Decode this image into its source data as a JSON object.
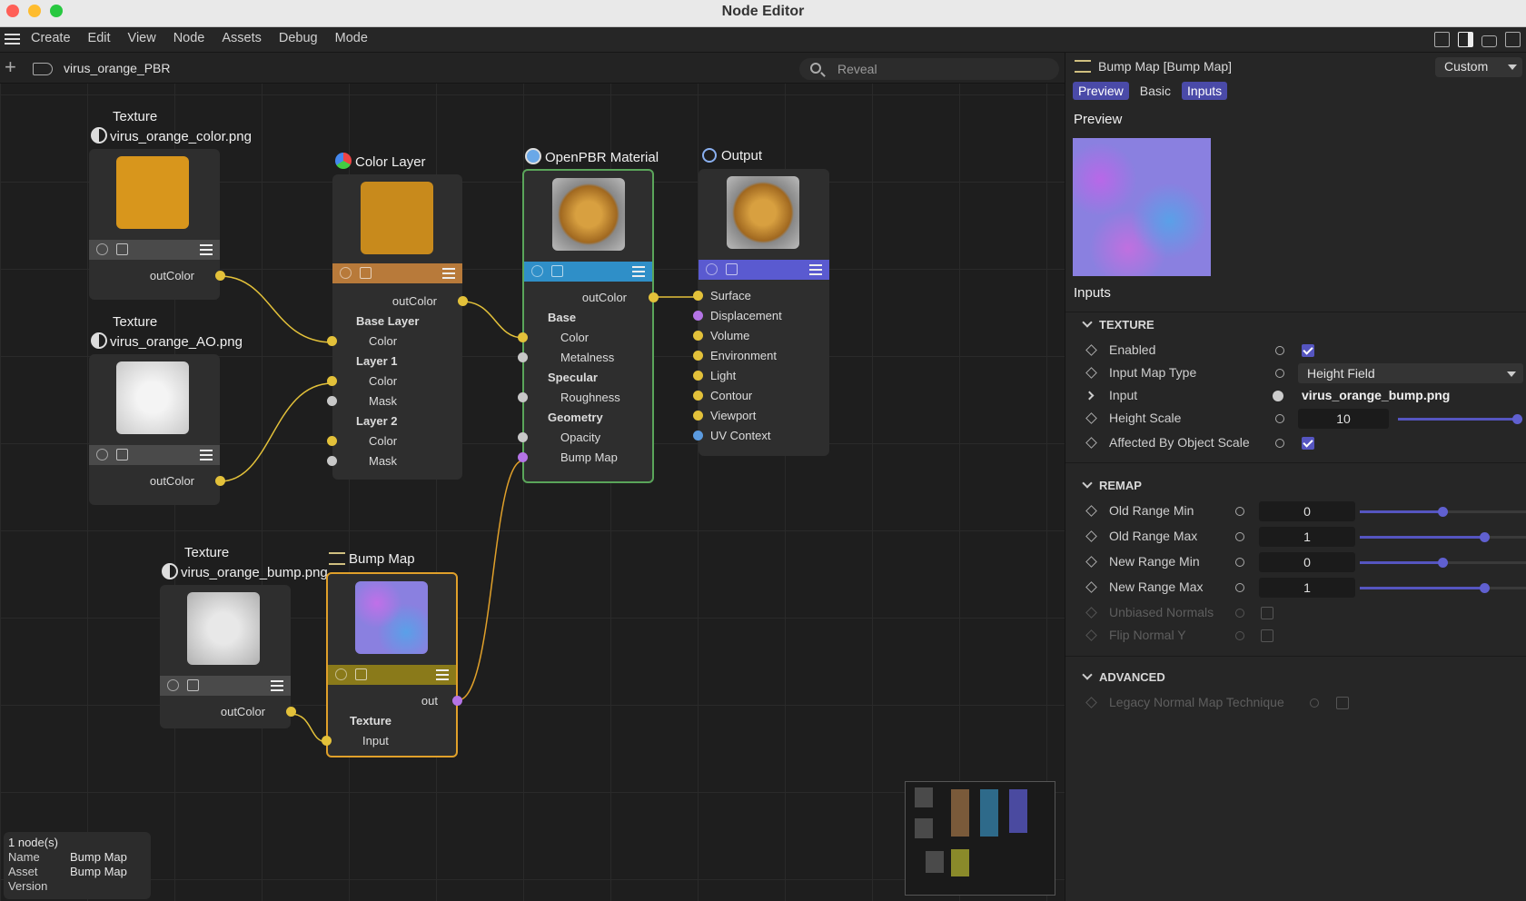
{
  "window": {
    "title": "Node Editor"
  },
  "menu": [
    "Create",
    "Edit",
    "View",
    "Node",
    "Assets",
    "Debug",
    "Mode"
  ],
  "path": {
    "name": "virus_orange_PBR"
  },
  "search": {
    "placeholder": "Reveal"
  },
  "nodes": {
    "tex_color": {
      "type": "Texture",
      "file": "virus_orange_color.png",
      "out": "outColor"
    },
    "tex_ao": {
      "type": "Texture",
      "file": "virus_orange_AO.png",
      "out": "outColor"
    },
    "tex_bump": {
      "type": "Texture",
      "file": "virus_orange_bump.png",
      "out": "outColor"
    },
    "color_layer": {
      "title": "Color Layer",
      "out": "outColor",
      "ports": [
        "Base Layer",
        "Color",
        "Layer 1",
        "Color",
        "Mask",
        "Layer 2",
        "Color",
        "Mask"
      ]
    },
    "openpbr": {
      "title": "OpenPBR Material",
      "out": "outColor",
      "ports": [
        "Base",
        "Color",
        "Metalness",
        "Specular",
        "Roughness",
        "Geometry",
        "Opacity",
        "Bump Map"
      ]
    },
    "output": {
      "title": "Output",
      "ports": [
        "Surface",
        "Displacement",
        "Volume",
        "Environment",
        "Light",
        "Contour",
        "Viewport",
        "UV Context"
      ]
    },
    "bump_map": {
      "title": "Bump Map",
      "out": "out",
      "ports": [
        "Texture",
        "Input"
      ]
    }
  },
  "selection": {
    "count": "1 node(s)",
    "name_key": "Name",
    "name": "Bump Map",
    "asset_key": "Asset",
    "asset": "Bump Map",
    "version_key": "Version"
  },
  "panel": {
    "title": "Bump Map [Bump Map]",
    "preset": "Custom",
    "tabs": [
      "Preview",
      "Basic",
      "Inputs"
    ],
    "preview_heading": "Preview",
    "inputs_heading": "Inputs",
    "groups": {
      "texture": "TEXTURE",
      "remap": "REMAP",
      "advanced": "ADVANCED"
    },
    "texture": {
      "enabled": {
        "label": "Enabled",
        "checked": true
      },
      "input_map_type": {
        "label": "Input Map Type",
        "value": "Height Field"
      },
      "input": {
        "label": "Input",
        "value": "virus_orange_bump.png"
      },
      "height_scale": {
        "label": "Height Scale",
        "value": "10",
        "fraction": 1.0
      },
      "affected": {
        "label": "Affected By Object Scale",
        "checked": true
      }
    },
    "remap": {
      "old_min": {
        "label": "Old Range Min",
        "value": "0",
        "fraction": 0.5
      },
      "old_max": {
        "label": "Old Range Max",
        "value": "1",
        "fraction": 0.75
      },
      "new_min": {
        "label": "New Range Min",
        "value": "0",
        "fraction": 0.5
      },
      "new_max": {
        "label": "New Range Max",
        "value": "1",
        "fraction": 0.75
      },
      "unbiased": {
        "label": "Unbiased Normals"
      },
      "flip": {
        "label": "Flip Normal Y"
      }
    },
    "advanced": {
      "legacy": {
        "label": "Legacy Normal Map Technique"
      }
    }
  },
  "colors": {
    "selected_border": "#e0a02a",
    "accent": "#5555c0",
    "port_yellow": "#e3c13a",
    "port_purple": "#b474e6"
  }
}
